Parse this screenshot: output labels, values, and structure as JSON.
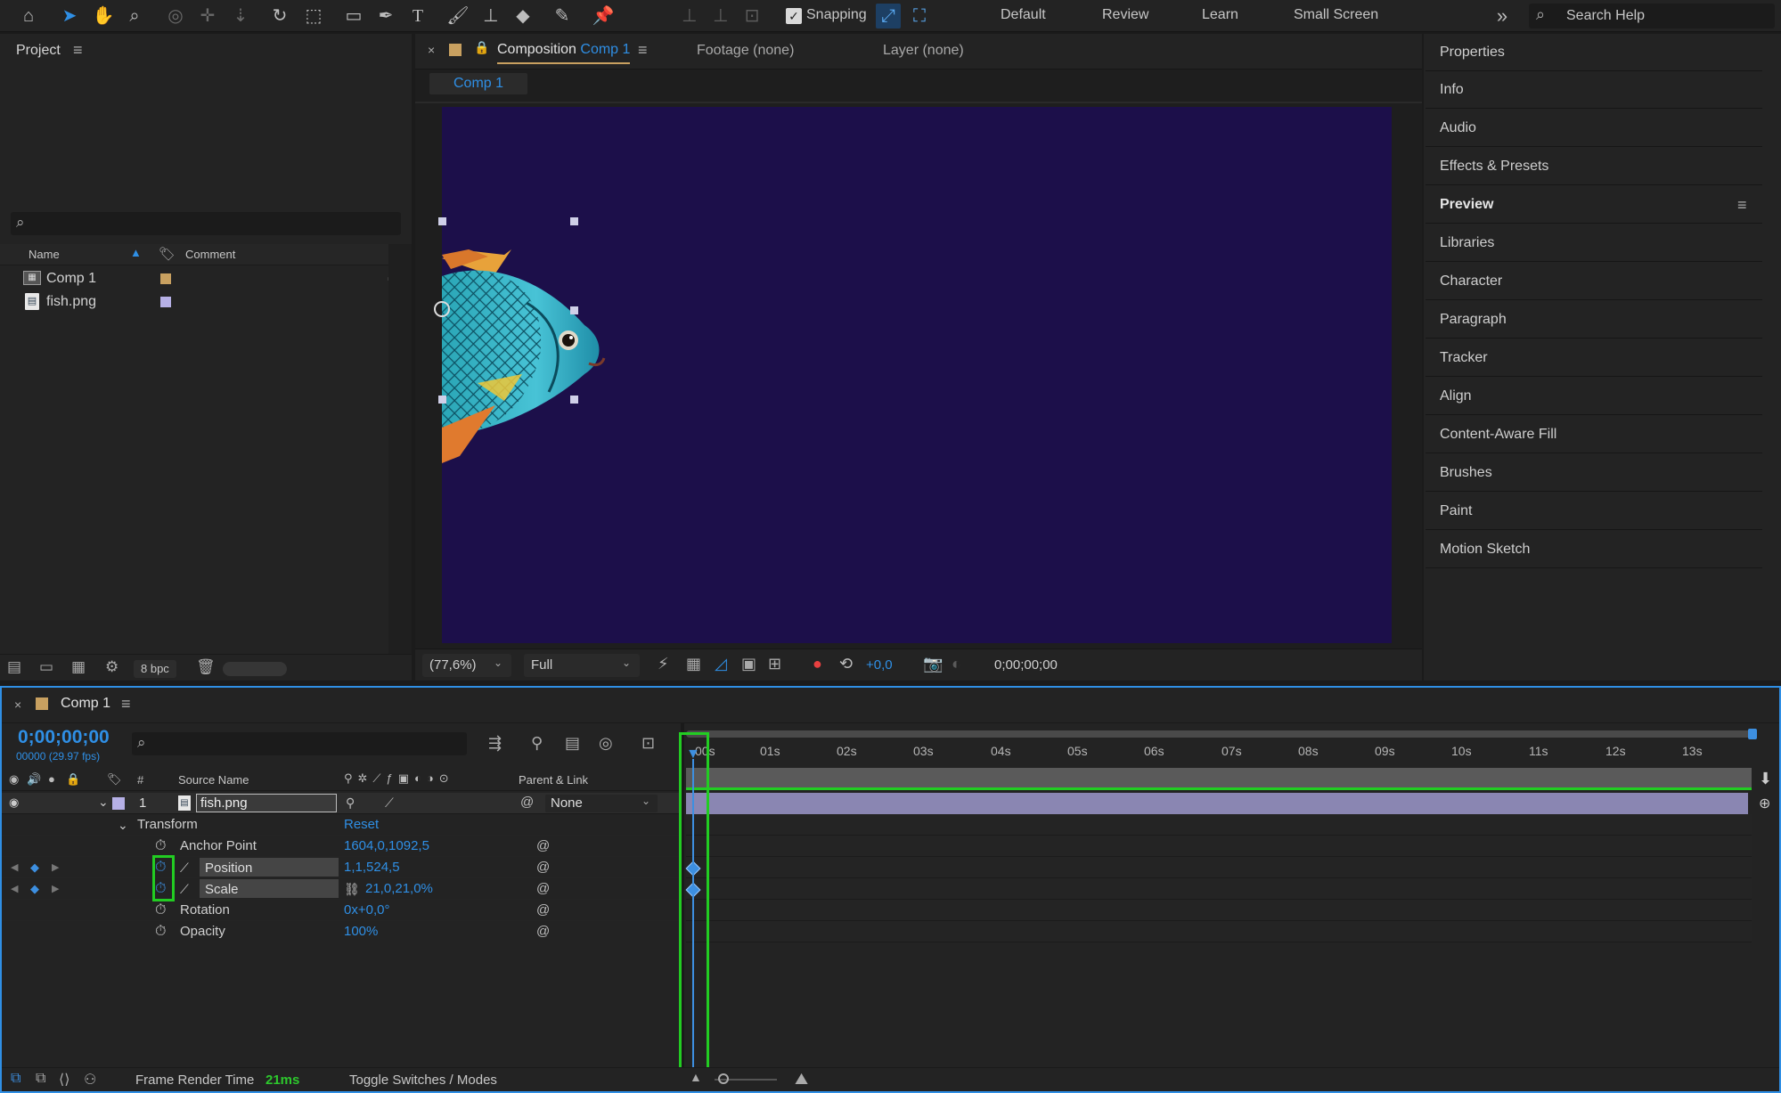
{
  "toolbar": {
    "snapping_label": "Snapping",
    "workspaces": [
      "Default",
      "Review",
      "Learn",
      "Small Screen"
    ],
    "search_placeholder": "Search Help"
  },
  "project": {
    "title": "Project",
    "columns": {
      "name": "Name",
      "comment": "Comment"
    },
    "items": [
      {
        "name": "Comp 1",
        "label_color": "#c8a060"
      },
      {
        "name": "fish.png",
        "label_color": "#b6b0e6"
      }
    ],
    "bpc": "8 bpc"
  },
  "viewer": {
    "tab_prefix": "Composition",
    "tab_comp": "Comp 1",
    "footage_tab": "Footage (none)",
    "layer_tab": "Layer (none)",
    "comp_subtab": "Comp 1",
    "zoom": "(77,6%)",
    "resolution": "Full",
    "exposure": "+0,0",
    "timecode": "0;00;00;00",
    "bg_color": "#1c0f4a"
  },
  "right_panels": [
    "Properties",
    "Info",
    "Audio",
    "Effects & Presets",
    "Preview",
    "Libraries",
    "Character",
    "Paragraph",
    "Tracker",
    "Align",
    "Content-Aware Fill",
    "Brushes",
    "Paint",
    "Motion Sketch"
  ],
  "timeline": {
    "tab": "Comp 1",
    "timecode": "0;00;00;00",
    "frame_info": "00000 (29.97 fps)",
    "col_num": "#",
    "col_source": "Source Name",
    "col_parent": "Parent & Link",
    "layer": {
      "index": "1",
      "name": "fish.png",
      "parent": "None"
    },
    "transform_label": "Transform",
    "reset_label": "Reset",
    "properties": [
      {
        "name": "Anchor Point",
        "value": "1604,0,1092,5"
      },
      {
        "name": "Position",
        "value": "1,1,524,5"
      },
      {
        "name": "Scale",
        "value": "21,0,21,0%"
      },
      {
        "name": "Rotation",
        "value": "0x+0,0°"
      },
      {
        "name": "Opacity",
        "value": "100%"
      }
    ],
    "ruler_ticks": [
      "00s",
      "01s",
      "02s",
      "03s",
      "04s",
      "05s",
      "06s",
      "07s",
      "08s",
      "09s",
      "10s",
      "11s",
      "12s",
      "13s"
    ],
    "frame_render_label": "Frame Render Time",
    "frame_render_value": "21ms",
    "toggle_label": "Toggle Switches / Modes",
    "highlight_color": "#22cc22"
  }
}
